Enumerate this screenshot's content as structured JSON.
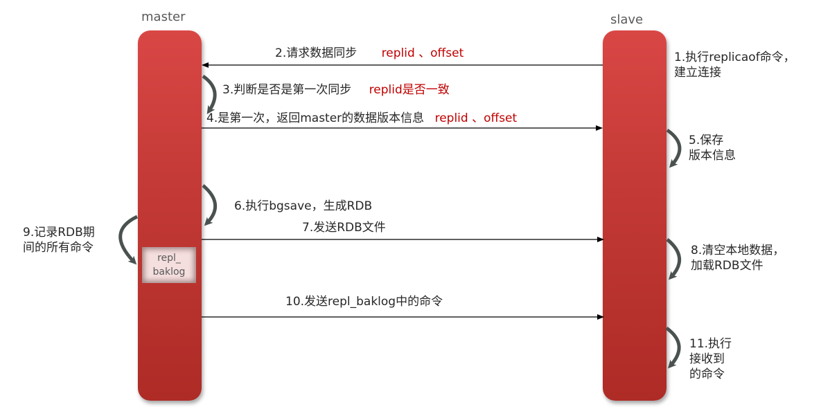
{
  "lanes": {
    "master": {
      "title": "master"
    },
    "slave": {
      "title": "slave"
    }
  },
  "backlog": {
    "line1": "repl_",
    "line2": "baklog"
  },
  "steps": {
    "s1": {
      "line1": "1.执行replicaof命令，",
      "line2": "建立连接"
    },
    "s2": {
      "text": "2.请求数据同步",
      "highlight": "replid 、offset"
    },
    "s3": {
      "text": "3.判断是否是第一次同步",
      "highlight": "replid是否一致"
    },
    "s4": {
      "text": "4.是第一次，返回master的数据版本信息",
      "highlight": "replid 、offset"
    },
    "s5": {
      "line1": "5.保存",
      "line2": "版本信息"
    },
    "s6": {
      "text": "6.执行bgsave，生成RDB"
    },
    "s7": {
      "text": "7.发送RDB文件"
    },
    "s8": {
      "line1": "8.清空本地数据，",
      "line2": "加载RDB文件"
    },
    "s9": {
      "line1": "9.记录RDB期",
      "line2": "间的所有命令"
    },
    "s10": {
      "text": "10.发送repl_baklog中的命令"
    },
    "s11": {
      "line1": "11.执行",
      "line2": "接收到",
      "line3": "的命令"
    }
  },
  "colors": {
    "lane_top": "#d94745",
    "lane_bottom": "#ae2b26",
    "highlight": "#c00000",
    "curved_arrow": "#4a5250",
    "text": "#262626"
  }
}
